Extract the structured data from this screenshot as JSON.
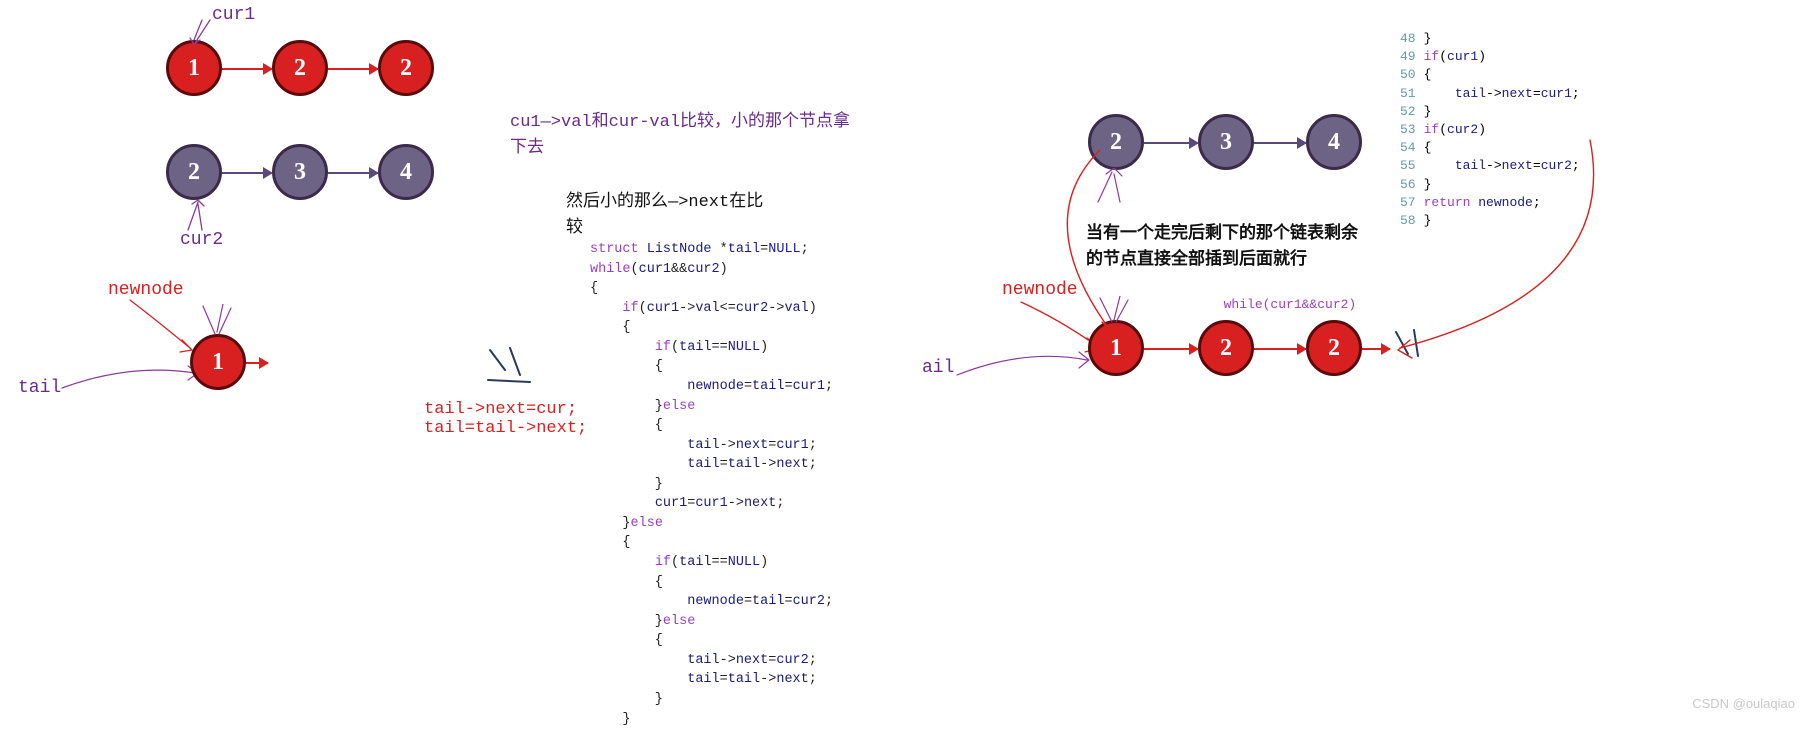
{
  "annotations": {
    "cur1": "cur1",
    "cur2": "cur2",
    "newnode_left": "newnode",
    "tail_left": "tail",
    "tail_ops": "tail->next=cur;\ntail=tail->next;",
    "desc_compare": "cu1—>val和cur-val比较，小的那个节点拿\n下去",
    "desc_next": "然后小的那么—>next在比\n较",
    "newnode_right": "newnode",
    "ail_right": "ail",
    "desc_remain": "当有一个走完后剩下的那个链表剩余\n的节点直接全部插到后面就行",
    "watermark": "CSDN @oulaqiao"
  },
  "nodes": {
    "list1": [
      "1",
      "2",
      "2"
    ],
    "list2": [
      "2",
      "3",
      "4"
    ],
    "single": "1",
    "right_top": [
      "2",
      "3",
      "4"
    ],
    "right_bottom": [
      "1",
      "2",
      "2"
    ]
  },
  "code_main": [
    {
      "t": "struct ListNode *tail=NULL;",
      "c": ""
    },
    {
      "t": "while(cur1&&cur2)",
      "c": "kw"
    },
    {
      "t": "{",
      "c": ""
    },
    {
      "t": "    if(cur1->val<=cur2->val)",
      "c": "kw"
    },
    {
      "t": "    {",
      "c": ""
    },
    {
      "t": "        if(tail==NULL)",
      "c": "kw"
    },
    {
      "t": "        {",
      "c": ""
    },
    {
      "t": "            newnode=tail=cur1;",
      "c": "id"
    },
    {
      "t": "        }else",
      "c": "kw"
    },
    {
      "t": "        {",
      "c": ""
    },
    {
      "t": "            tail->next=cur1;",
      "c": "id"
    },
    {
      "t": "            tail=tail->next;",
      "c": "id"
    },
    {
      "t": "        }",
      "c": ""
    },
    {
      "t": "        cur1=cur1->next;",
      "c": "id"
    },
    {
      "t": "    }else",
      "c": "kw"
    },
    {
      "t": "    {",
      "c": ""
    },
    {
      "t": "        if(tail==NULL)",
      "c": "kw"
    },
    {
      "t": "        {",
      "c": ""
    },
    {
      "t": "            newnode=tail=cur2;",
      "c": "id"
    },
    {
      "t": "        }else",
      "c": "kw"
    },
    {
      "t": "        {",
      "c": ""
    },
    {
      "t": "            tail->next=cur2;",
      "c": "id"
    },
    {
      "t": "            tail=tail->next;",
      "c": "id"
    },
    {
      "t": "        }",
      "c": ""
    },
    {
      "t": "    }",
      "c": ""
    }
  ],
  "code_right_small": "while(cur1&&cur2)",
  "code_right_nums": [
    {
      "n": "48",
      "t": "}"
    },
    {
      "n": "49",
      "t": "if(cur1)"
    },
    {
      "n": "50",
      "t": "{"
    },
    {
      "n": "51",
      "t": "    tail->next=cur1;"
    },
    {
      "n": "52",
      "t": "}"
    },
    {
      "n": "53",
      "t": "if(cur2)"
    },
    {
      "n": "54",
      "t": "{"
    },
    {
      "n": "55",
      "t": "    tail->next=cur2;"
    },
    {
      "n": "56",
      "t": "}"
    },
    {
      "n": "57",
      "t": "return newnode;"
    },
    {
      "n": "58",
      "t": "}"
    }
  ]
}
